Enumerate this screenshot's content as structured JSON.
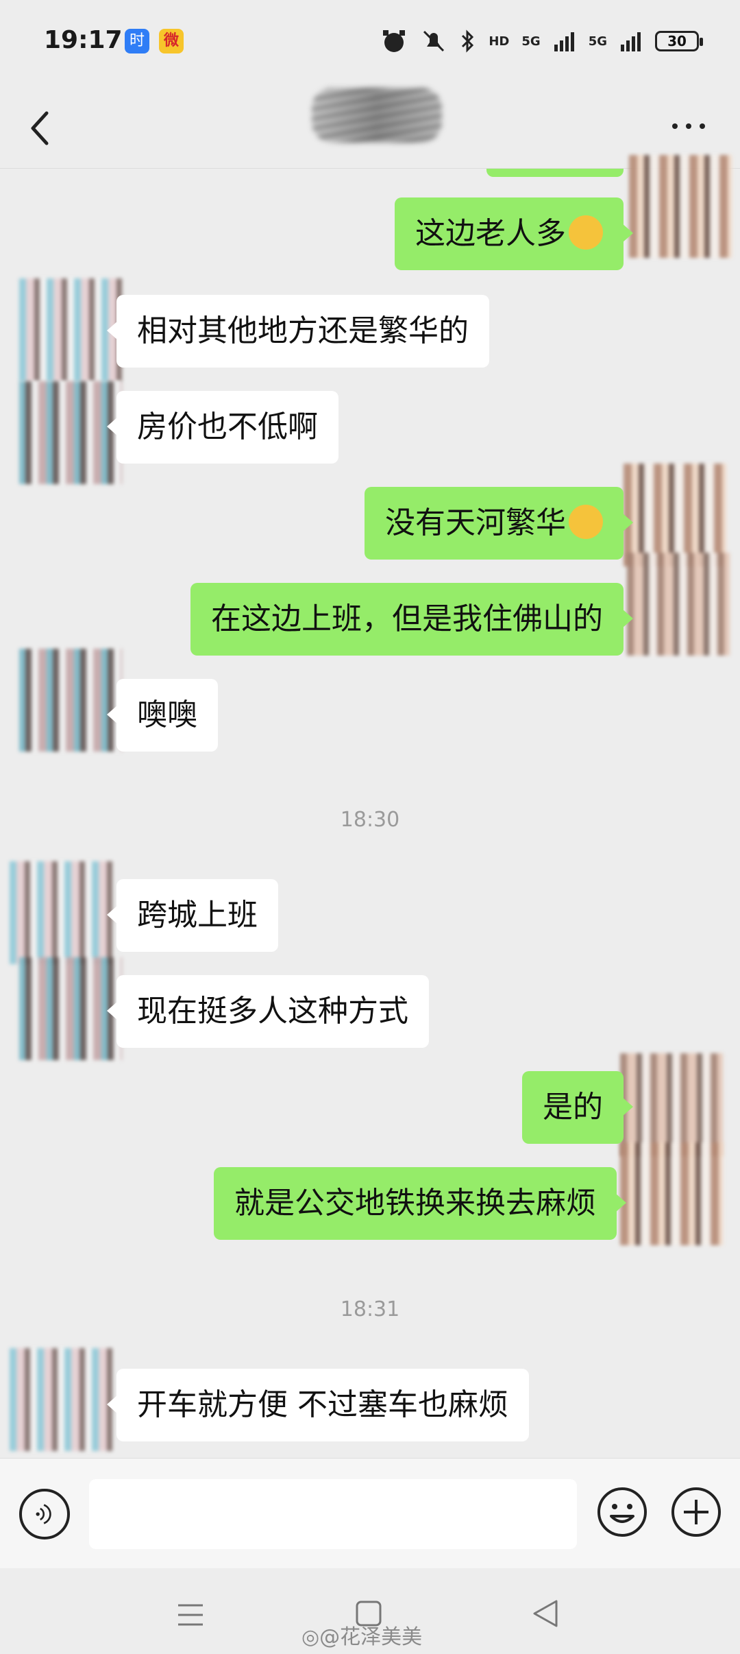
{
  "status_bar": {
    "time": "19:17",
    "badge_shi": "时",
    "badge_weibo": "微",
    "net_labels": [
      "HD",
      "5G",
      "5G"
    ],
    "battery": "30"
  },
  "nav": {
    "back_icon": "chevron-left-icon",
    "more_icon": "more-dots-icon"
  },
  "messages": [
    {
      "side": "right",
      "text": "这边老人多",
      "emoji": true
    },
    {
      "side": "left",
      "text": "相对其他地方还是繁华的"
    },
    {
      "side": "left",
      "text": "房价也不低啊"
    },
    {
      "side": "right",
      "text": "没有天河繁华",
      "emoji": true
    },
    {
      "side": "right",
      "text": "在这边上班，但是我住佛山的"
    },
    {
      "side": "left",
      "text": "噢噢"
    },
    {
      "side": "left",
      "text": "跨城上班"
    },
    {
      "side": "left",
      "text": "现在挺多人这种方式"
    },
    {
      "side": "right",
      "text": "是的"
    },
    {
      "side": "right",
      "text": "就是公交地铁换来换去麻烦"
    },
    {
      "side": "left",
      "text": "开车就方便 不过塞车也麻烦"
    }
  ],
  "timestamps": [
    "18:30",
    "18:31"
  ],
  "input": {
    "placeholder": ""
  },
  "watermark": "◎@花泽美美",
  "colors": {
    "bubble_right": "#95ec69",
    "bubble_left": "#ffffff",
    "background": "#ededed"
  }
}
